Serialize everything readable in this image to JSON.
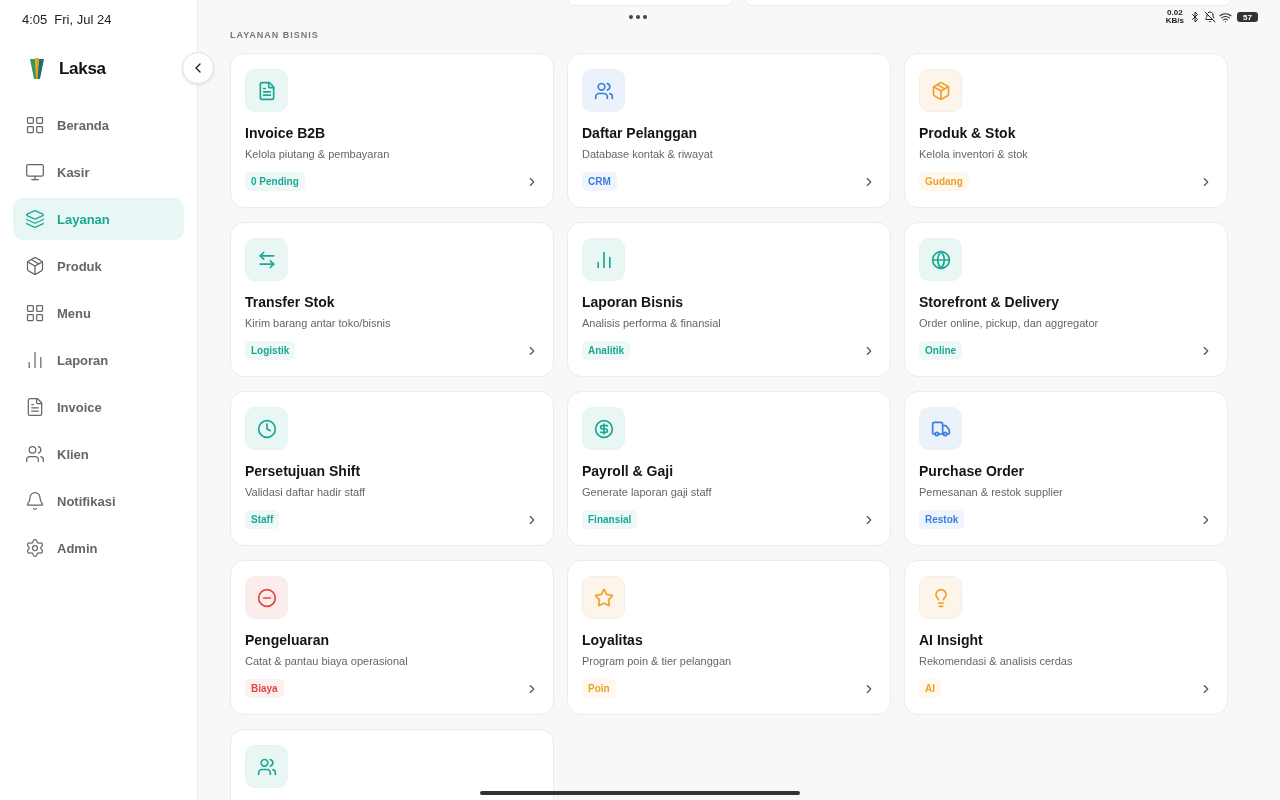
{
  "status_bar": {
    "time": "4:05",
    "date": "Fri, Jul 24",
    "net_speed": [
      "0.02",
      "KB/s"
    ],
    "battery": "57"
  },
  "sidebar": {
    "brand": "Laksa",
    "items": [
      {
        "label": "Beranda",
        "selected": false
      },
      {
        "label": "Kasir",
        "selected": false
      },
      {
        "label": "Layanan",
        "selected": true
      },
      {
        "label": "Produk",
        "selected": false
      },
      {
        "label": "Menu",
        "selected": false
      },
      {
        "label": "Laporan",
        "selected": false
      },
      {
        "label": "Invoice",
        "selected": false
      },
      {
        "label": "Klien",
        "selected": false
      },
      {
        "label": "Notifikasi",
        "selected": false
      },
      {
        "label": "Admin",
        "selected": false
      }
    ]
  },
  "section_title": "LAYANAN BISNIS",
  "cards": [
    {
      "title": "Invoice B2B",
      "description": "Kelola piutang & pembayaran",
      "badge": "0 Pending",
      "color": "#1aa894"
    },
    {
      "title": "Daftar Pelanggan",
      "description": "Database kontak & riwayat",
      "badge": "CRM",
      "color": "#3b7de0"
    },
    {
      "title": "Produk & Stok",
      "description": "Kelola inventori & stok",
      "badge": "Gudang",
      "color": "#eea02a"
    },
    {
      "title": "Transfer Stok",
      "description": "Kirim barang antar toko/bisnis",
      "badge": "Logistik",
      "color": "#1aa894"
    },
    {
      "title": "Laporan Bisnis",
      "description": "Analisis performa & finansial",
      "badge": "Analitik",
      "color": "#1aa894"
    },
    {
      "title": "Storefront & Delivery",
      "description": "Order online, pickup, dan aggregator",
      "badge": "Online",
      "color": "#1aa894"
    },
    {
      "title": "Persetujuan Shift",
      "description": "Validasi daftar hadir staff",
      "badge": "Staff",
      "color": "#1aa894"
    },
    {
      "title": "Payroll & Gaji",
      "description": "Generate laporan gaji staff",
      "badge": "Finansial",
      "color": "#1aa894"
    },
    {
      "title": "Purchase Order",
      "description": "Pemesanan & restok supplier",
      "badge": "Restok",
      "color": "#3b7de0"
    },
    {
      "title": "Pengeluaran",
      "description": "Catat & pantau biaya operasional",
      "badge": "Biaya",
      "color": "#e2463f"
    },
    {
      "title": "Loyalitas",
      "description": "Program poin & tier pelanggan",
      "badge": "Poin",
      "color": "#eea02a"
    },
    {
      "title": "AI Insight",
      "description": "Rekomendasi & analisis cerdas",
      "badge": "AI",
      "color": "#eea02a"
    },
    {
      "color": "#1aa894"
    }
  ]
}
